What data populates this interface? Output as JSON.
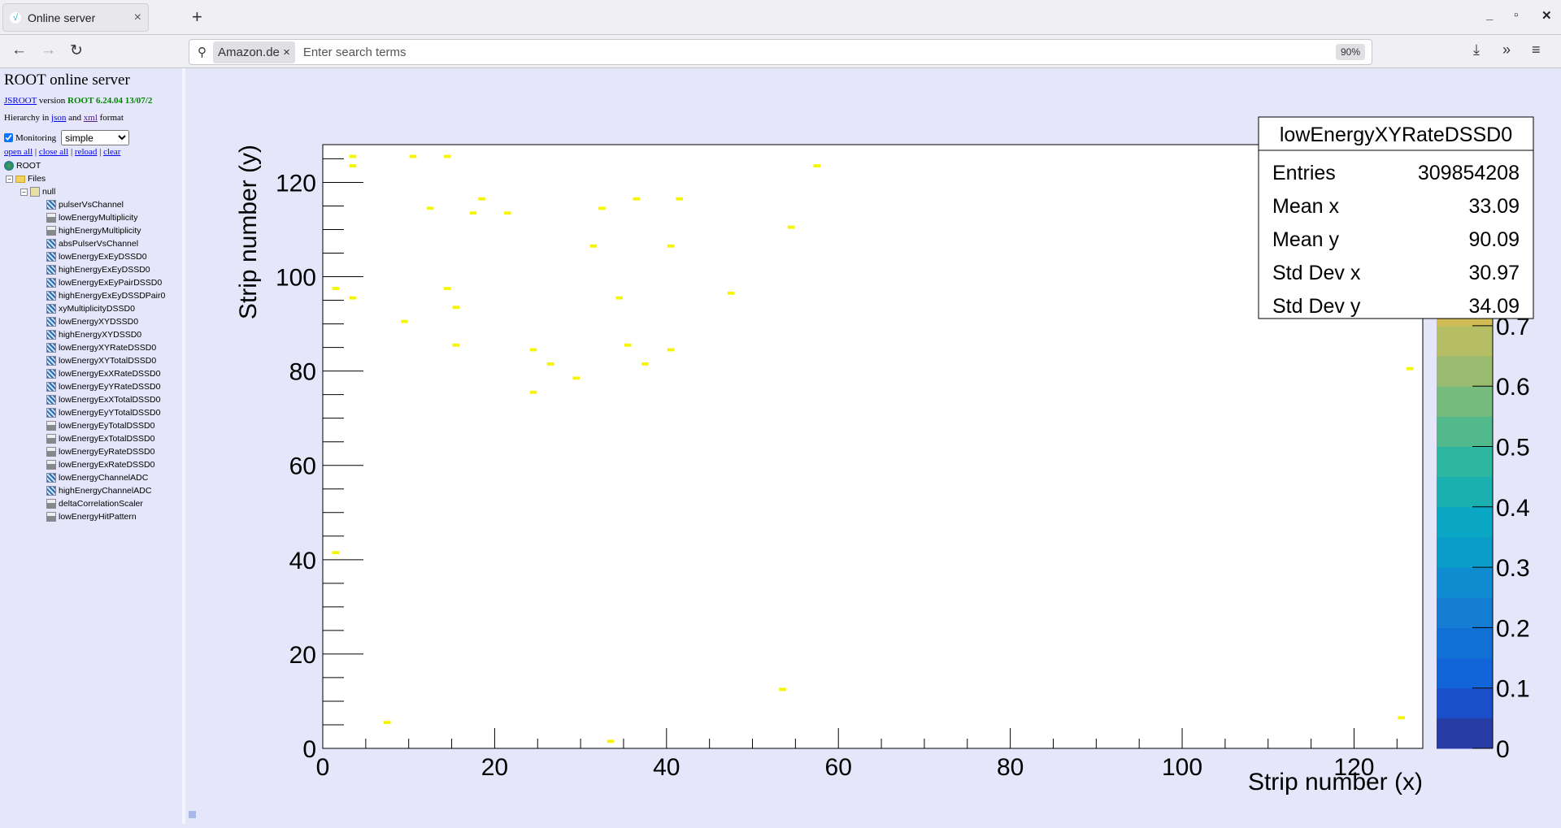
{
  "browser": {
    "tab_title": "Online server",
    "new_tab": "+",
    "tab_close": "×",
    "search_chip": "Amazon.de",
    "search_chip_close": "×",
    "search_placeholder": "Enter search terms",
    "zoom": "90%",
    "icons": [
      "back-icon",
      "forward-icon",
      "reload-icon",
      "search-icon",
      "download-icon",
      "overflow-icon",
      "menu-icon",
      "minimize-icon",
      "maximize-icon",
      "close-icon"
    ]
  },
  "left": {
    "title": "ROOT online server",
    "jsroot_link": "JSROOT",
    "version_text": "version",
    "version": "ROOT 6.24.04 13/07/2",
    "hier_prefix": "Hierarchy in",
    "json_link": "json",
    "and": "and",
    "xml_link": "xml",
    "format": "format",
    "monitoring_label": "Monitoring",
    "monitoring_checked": true,
    "monitoring_mode": "simple",
    "actions": {
      "open_all": "open all",
      "close_all": "close all",
      "reload": "reload",
      "clear": "clear",
      "sep": "|"
    },
    "tree": {
      "root": "ROOT",
      "files": "Files",
      "null": "null",
      "items": [
        {
          "label": "pulserVsChannel",
          "type": "h2"
        },
        {
          "label": "lowEnergyMultiplicity",
          "type": "h1"
        },
        {
          "label": "highEnergyMultiplicity",
          "type": "h1"
        },
        {
          "label": "absPulserVsChannel",
          "type": "h2"
        },
        {
          "label": "lowEnergyExEyDSSD0",
          "type": "h2"
        },
        {
          "label": "highEnergyExEyDSSD0",
          "type": "h2"
        },
        {
          "label": "lowEnergyExEyPairDSSD0",
          "type": "h2"
        },
        {
          "label": "highEnergyExEyDSSDPair0",
          "type": "h2"
        },
        {
          "label": "xyMultiplicityDSSD0",
          "type": "h2"
        },
        {
          "label": "lowEnergyXYDSSD0",
          "type": "h2"
        },
        {
          "label": "highEnergyXYDSSD0",
          "type": "h2"
        },
        {
          "label": "lowEnergyXYRateDSSD0",
          "type": "h2"
        },
        {
          "label": "lowEnergyXYTotalDSSD0",
          "type": "h2"
        },
        {
          "label": "lowEnergyExXRateDSSD0",
          "type": "h2"
        },
        {
          "label": "lowEnergyEyYRateDSSD0",
          "type": "h2"
        },
        {
          "label": "lowEnergyExXTotalDSSD0",
          "type": "h2"
        },
        {
          "label": "lowEnergyEyYTotalDSSD0",
          "type": "h2"
        },
        {
          "label": "lowEnergyEyTotalDSSD0",
          "type": "h1"
        },
        {
          "label": "lowEnergyExTotalDSSD0",
          "type": "h1"
        },
        {
          "label": "lowEnergyEyRateDSSD0",
          "type": "h1"
        },
        {
          "label": "lowEnergyExRateDSSD0",
          "type": "h1"
        },
        {
          "label": "lowEnergyChannelADC",
          "type": "h2"
        },
        {
          "label": "highEnergyChannelADC",
          "type": "h2"
        },
        {
          "label": "deltaCorrelationScaler",
          "type": "h1"
        },
        {
          "label": "lowEnergyHitPattern",
          "type": "h1"
        }
      ]
    }
  },
  "stats": {
    "title": "lowEnergyXYRateDSSD0",
    "rows": [
      {
        "label": "Entries",
        "value": "309854208"
      },
      {
        "label": "Mean x",
        "value": "33.09"
      },
      {
        "label": "Mean y",
        "value": "90.09"
      },
      {
        "label": "Std Dev x",
        "value": "30.97"
      },
      {
        "label": "Std Dev y",
        "value": "34.09"
      }
    ]
  },
  "chart_data": {
    "type": "heatmap",
    "title": "",
    "xlabel": "Strip number (x)",
    "ylabel": "Strip number (y)",
    "xlim": [
      0,
      128
    ],
    "ylim": [
      0,
      128
    ],
    "zlim": [
      0,
      1
    ],
    "xticks": [
      0,
      20,
      40,
      60,
      80,
      100,
      120
    ],
    "yticks": [
      0,
      20,
      40,
      60,
      80,
      100,
      120
    ],
    "zticks": [
      "0",
      "0.1",
      "0.2",
      "0.3",
      "0.4",
      "0.5",
      "0.6",
      "0.7"
    ],
    "grid": false,
    "bin_color": "#f5f500",
    "palette": [
      "#283ca6",
      "#1a4fc9",
      "#1264d9",
      "#1170d4",
      "#157dd1",
      "#0f8ccf",
      "#0b9dc9",
      "#0aa7c4",
      "#1ab0b0",
      "#2db7a0",
      "#52b98d",
      "#76bb7d",
      "#99bb6f",
      "#b5bd65",
      "#d1bb56",
      "#e9b945",
      "#f9c234",
      "#f7d52c",
      "#f5e624",
      "#f9fb0e"
    ],
    "bins": [
      [
        1,
        41
      ],
      [
        1,
        97
      ],
      [
        3,
        125
      ],
      [
        3,
        123
      ],
      [
        3,
        95
      ],
      [
        7,
        5
      ],
      [
        9,
        90
      ],
      [
        10,
        125
      ],
      [
        12,
        114
      ],
      [
        14,
        125
      ],
      [
        14,
        97
      ],
      [
        15,
        93
      ],
      [
        15,
        85
      ],
      [
        17,
        113
      ],
      [
        18,
        116
      ],
      [
        21,
        113
      ],
      [
        24,
        84
      ],
      [
        24,
        75
      ],
      [
        26,
        81
      ],
      [
        29,
        78
      ],
      [
        31,
        106
      ],
      [
        32,
        114
      ],
      [
        33,
        1
      ],
      [
        34,
        95
      ],
      [
        35,
        85
      ],
      [
        36,
        116
      ],
      [
        37,
        81
      ],
      [
        40,
        106
      ],
      [
        40,
        84
      ],
      [
        41,
        116
      ],
      [
        47,
        96
      ],
      [
        53,
        12
      ],
      [
        54,
        110
      ],
      [
        57,
        123
      ],
      [
        125,
        6
      ],
      [
        126,
        80
      ]
    ],
    "bin_value": 1
  }
}
